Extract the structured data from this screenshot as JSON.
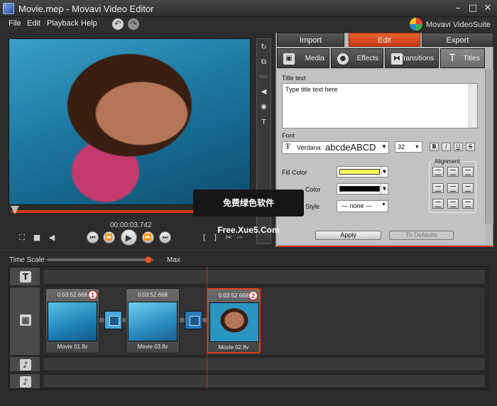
{
  "window": {
    "title": "Movie.mep - Movavi Video Editor"
  },
  "menu": [
    "File",
    "Edit",
    "Playback",
    "Help"
  ],
  "suite": {
    "name": "Movavi VideoSuite"
  },
  "player": {
    "timecode": "00:00:03.742",
    "progress_fraction": 0.77
  },
  "panel": {
    "tabs": [
      "Import",
      "Edit",
      "Export"
    ],
    "active_tab": "Edit",
    "subtabs": [
      "Media",
      "Effects",
      "Transitions",
      "Titles"
    ],
    "active_subtab": "Titles",
    "title_text_label": "Title text",
    "title_text_value": "Type title text here",
    "font_label": "Font",
    "font_name": "Verdana",
    "font_preview": "abcdeABCD",
    "font_size": "32",
    "style_buttons": [
      "B",
      "I",
      "U",
      "S"
    ],
    "fill_color_label": "Fill Color",
    "fill_color": "#ffff55",
    "outline_color_label": "Color",
    "outline_color": "#000000",
    "style_label": "Style",
    "style_value": "— none —",
    "alignment_label": "Alignment",
    "apply_label": "Apply",
    "defaults_label": "To Defaults"
  },
  "timeline": {
    "timescale_label": "Time Scale",
    "max_label": "Max",
    "timescale_fraction": 0.95,
    "clips": [
      {
        "time": "0:03:52.668",
        "name": "Movie 01.flv",
        "badge": "1"
      },
      {
        "time": "0:03:52.668",
        "name": "Movie 03.flv",
        "badge": ""
      },
      {
        "time": "0:03:52.668",
        "name": "Movie 02.flv",
        "badge": "2"
      }
    ]
  },
  "watermark": "免费绿色软件Free.Xue5.Com",
  "colors": {
    "accent": "#e2401c",
    "active_tab": "#d6431d"
  }
}
